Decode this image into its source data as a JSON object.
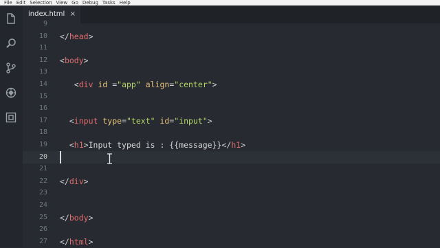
{
  "menu": [
    "File",
    "Edit",
    "Selection",
    "View",
    "Go",
    "Debug",
    "Tasks",
    "Help"
  ],
  "activity_icons": [
    "explorer-icon",
    "search-icon",
    "source-control-icon",
    "debug-icon",
    "extensions-icon"
  ],
  "tab": {
    "title": "index.html",
    "close": "×"
  },
  "lines": [
    {
      "n": "9",
      "indent": "",
      "code": []
    },
    {
      "n": "10",
      "indent": "",
      "code": [
        {
          "t": "punc",
          "v": "</"
        },
        {
          "t": "tag",
          "v": "head"
        },
        {
          "t": "punc",
          "v": ">"
        }
      ]
    },
    {
      "n": "11",
      "indent": "",
      "code": []
    },
    {
      "n": "12",
      "indent": "",
      "code": [
        {
          "t": "punc",
          "v": "<"
        },
        {
          "t": "tag",
          "v": "body"
        },
        {
          "t": "punc",
          "v": ">"
        }
      ]
    },
    {
      "n": "13",
      "indent": "",
      "code": []
    },
    {
      "n": "14",
      "indent": "   ",
      "code": [
        {
          "t": "punc",
          "v": "<"
        },
        {
          "t": "tag",
          "v": "div"
        },
        {
          "t": "txt",
          "v": " "
        },
        {
          "t": "attr",
          "v": "id"
        },
        {
          "t": "punc",
          "v": " ="
        },
        {
          "t": "str",
          "v": "\"app\""
        },
        {
          "t": "txt",
          "v": " "
        },
        {
          "t": "attr",
          "v": "align"
        },
        {
          "t": "punc",
          "v": "="
        },
        {
          "t": "str",
          "v": "\"center\""
        },
        {
          "t": "punc",
          "v": ">"
        }
      ]
    },
    {
      "n": "15",
      "indent": "",
      "code": []
    },
    {
      "n": "16",
      "indent": "",
      "code": []
    },
    {
      "n": "17",
      "indent": "  ",
      "code": [
        {
          "t": "punc",
          "v": "<"
        },
        {
          "t": "tag",
          "v": "input"
        },
        {
          "t": "txt",
          "v": " "
        },
        {
          "t": "attr",
          "v": "type"
        },
        {
          "t": "punc",
          "v": "="
        },
        {
          "t": "str",
          "v": "\"text\""
        },
        {
          "t": "txt",
          "v": " "
        },
        {
          "t": "attr",
          "v": "id"
        },
        {
          "t": "punc",
          "v": "="
        },
        {
          "t": "str",
          "v": "\"input\""
        },
        {
          "t": "punc",
          "v": ">"
        }
      ]
    },
    {
      "n": "18",
      "indent": "",
      "code": []
    },
    {
      "n": "19",
      "indent": "  ",
      "code": [
        {
          "t": "punc",
          "v": "<"
        },
        {
          "t": "tag",
          "v": "h1"
        },
        {
          "t": "punc",
          "v": ">"
        },
        {
          "t": "txt",
          "v": "Input typed is : {{message}}"
        },
        {
          "t": "punc",
          "v": "</"
        },
        {
          "t": "tag",
          "v": "h1"
        },
        {
          "t": "punc",
          "v": ">"
        }
      ]
    },
    {
      "n": "20",
      "indent": "",
      "code": [],
      "active": true
    },
    {
      "n": "21",
      "indent": "",
      "code": []
    },
    {
      "n": "22",
      "indent": "",
      "code": [
        {
          "t": "punc",
          "v": "</"
        },
        {
          "t": "tag",
          "v": "div"
        },
        {
          "t": "punc",
          "v": ">"
        }
      ]
    },
    {
      "n": "23",
      "indent": "",
      "code": []
    },
    {
      "n": "24",
      "indent": "",
      "code": []
    },
    {
      "n": "25",
      "indent": "",
      "code": [
        {
          "t": "punc",
          "v": "</"
        },
        {
          "t": "tag",
          "v": "body"
        },
        {
          "t": "punc",
          "v": ">"
        }
      ]
    },
    {
      "n": "26",
      "indent": "",
      "code": []
    },
    {
      "n": "27",
      "indent": "",
      "code": [
        {
          "t": "punc",
          "v": "</"
        },
        {
          "t": "tag",
          "v": "html"
        },
        {
          "t": "punc",
          "v": ">"
        }
      ]
    }
  ]
}
